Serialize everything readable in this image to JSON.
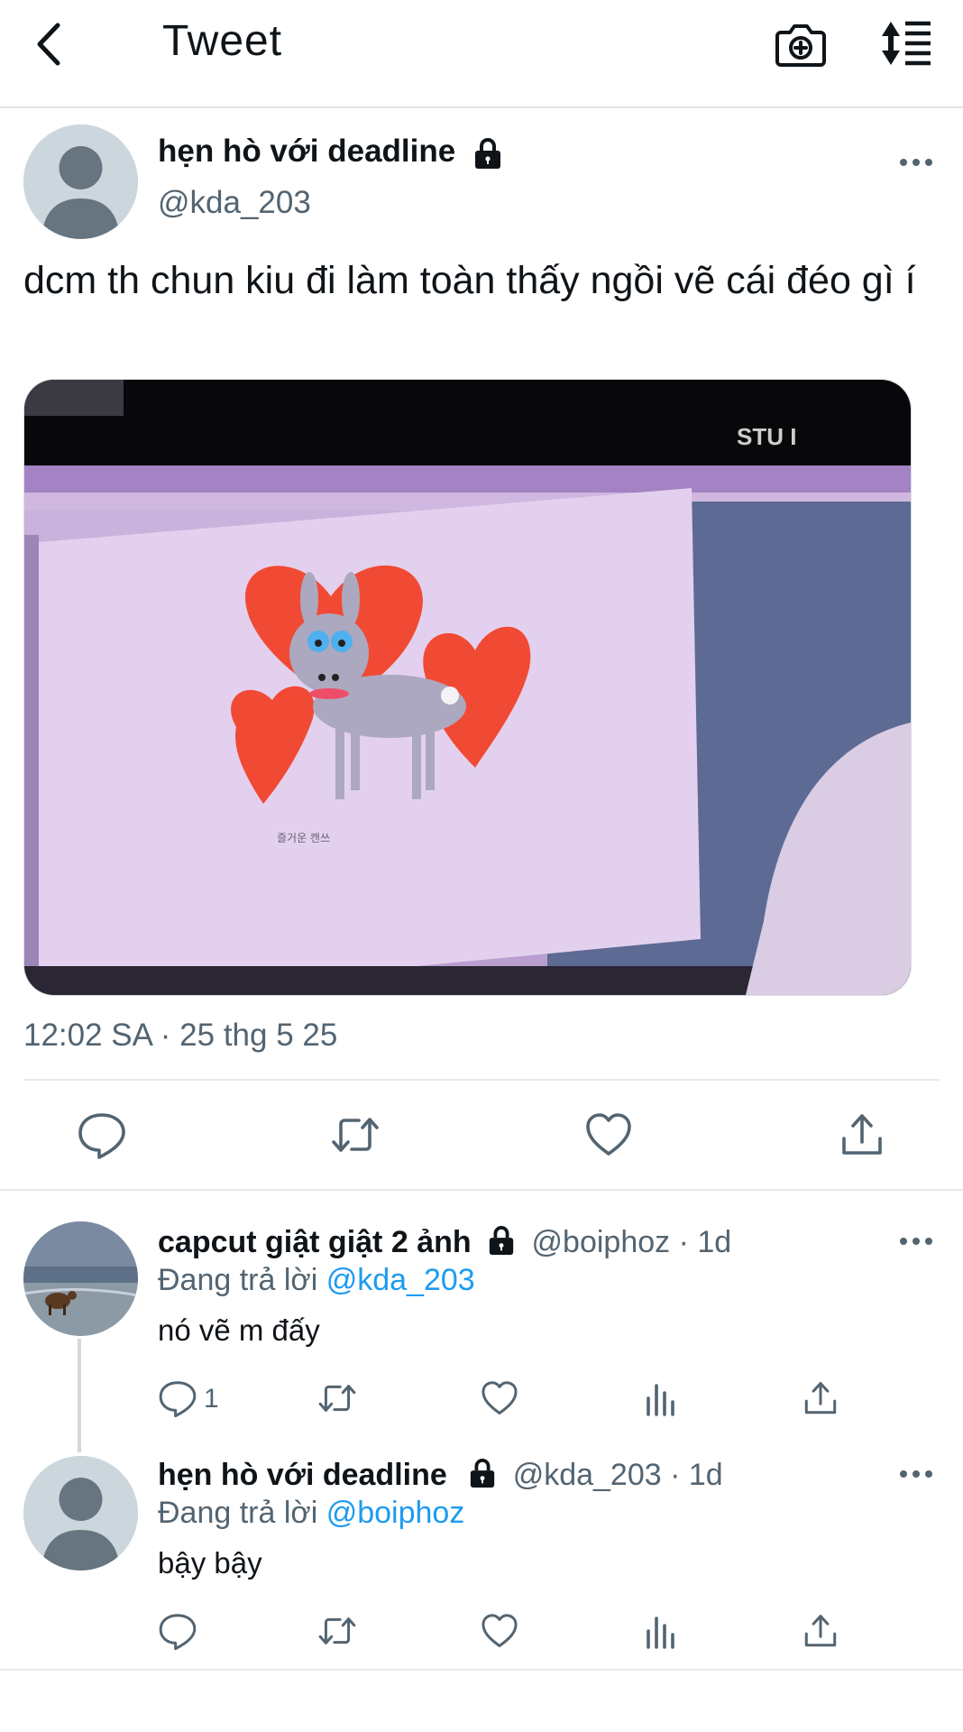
{
  "header": {
    "title": "Tweet"
  },
  "tweet": {
    "author_name": "hẹn hò với deadline",
    "author_handle": "@kda_203",
    "text": "dcm th chun kiu đi làm toàn thấy ngồi vẽ cái đéo gì í",
    "timestamp": "12:02 SA · 25 thg 5 25",
    "media_overlay_text": "STU I",
    "media_caption": "즐거운 캔쓰"
  },
  "replies": [
    {
      "author_name": "capcut giật giật 2 ảnh",
      "author_handle": "@boiphoz",
      "time": "· 1d",
      "replying_prefix": "Đang trả lời",
      "replying_to": "@kda_203",
      "text": "nó vẽ m đấy",
      "reply_count": "1"
    },
    {
      "author_name": "hẹn hò với deadline",
      "author_handle": "@kda_203",
      "time": "· 1d",
      "replying_prefix": "Đang trả lời",
      "replying_to": "@boiphoz",
      "text": "bậy bậy",
      "reply_count": ""
    }
  ],
  "icons": {
    "back": "chevron-left-icon",
    "camera": "camera-plus-icon",
    "sort": "sort-icon",
    "lock": "lock-icon",
    "more": "more-dots-icon",
    "reply": "reply-bubble-icon",
    "retweet": "retweet-icon",
    "like": "heart-icon",
    "views": "bar-chart-icon",
    "share": "share-icon"
  },
  "colors": {
    "link": "#1d9bf0",
    "secondary_text": "#536471",
    "divider": "#e6e9ec"
  }
}
